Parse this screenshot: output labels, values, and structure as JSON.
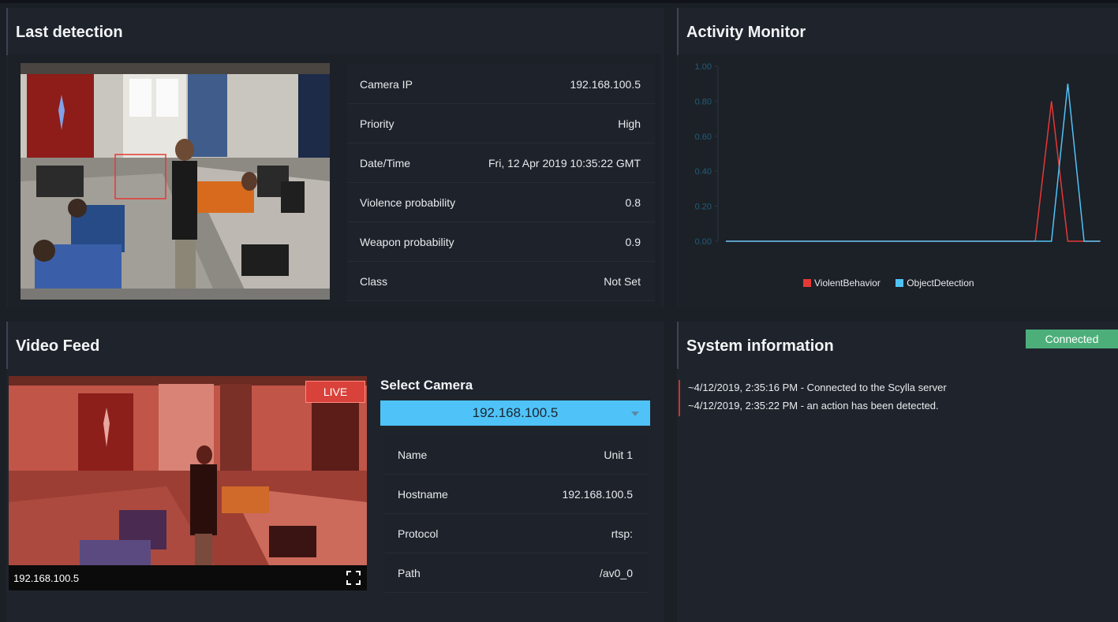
{
  "last_detection": {
    "title": "Last detection",
    "rows": [
      {
        "key": "Camera IP",
        "value": "192.168.100.5"
      },
      {
        "key": "Priority",
        "value": "High"
      },
      {
        "key": "Date/Time",
        "value": "Fri, 12 Apr 2019 10:35:22 GMT"
      },
      {
        "key": "Violence probability",
        "value": "0.8"
      },
      {
        "key": "Weapon probability",
        "value": "0.9"
      },
      {
        "key": "Class",
        "value": "Not Set"
      }
    ]
  },
  "activity_monitor": {
    "title": "Activity Monitor",
    "chart_data": {
      "type": "line",
      "ylim": [
        0,
        1
      ],
      "y_ticks": [
        "1.00",
        "0.80",
        "0.60",
        "0.40",
        "0.20",
        "0.00"
      ],
      "grid": false,
      "legend_position": "bottom-center",
      "series": [
        {
          "name": "ViolentBehavior",
          "color": "#e53935",
          "values": [
            0,
            0,
            0,
            0,
            0,
            0,
            0,
            0,
            0,
            0,
            0,
            0,
            0,
            0,
            0,
            0,
            0,
            0,
            0,
            0,
            0.8,
            0,
            0,
            0
          ]
        },
        {
          "name": "ObjectDetection",
          "color": "#4fc3f7",
          "values": [
            0,
            0,
            0,
            0,
            0,
            0,
            0,
            0,
            0,
            0,
            0,
            0,
            0,
            0,
            0,
            0,
            0,
            0,
            0,
            0,
            0,
            0.9,
            0,
            0
          ]
        }
      ]
    }
  },
  "video_feed": {
    "title": "Video Feed",
    "live_label": "LIVE",
    "camera_ip": "192.168.100.5",
    "fullscreen_icon": "fullscreen-icon"
  },
  "select_camera": {
    "label": "Select Camera",
    "selected": "192.168.100.5",
    "rows": [
      {
        "key": "Name",
        "value": "Unit 1"
      },
      {
        "key": "Hostname",
        "value": "192.168.100.5"
      },
      {
        "key": "Protocol",
        "value": "rtsp:"
      },
      {
        "key": "Path",
        "value": "/av0_0"
      }
    ]
  },
  "system_information": {
    "title": "System information",
    "status": "Connected",
    "status_color": "#4caf7a",
    "log": [
      "~4/12/2019, 2:35:16 PM - Connected to the Scylla server",
      "~4/12/2019, 2:35:22 PM - an action has been detected."
    ]
  }
}
